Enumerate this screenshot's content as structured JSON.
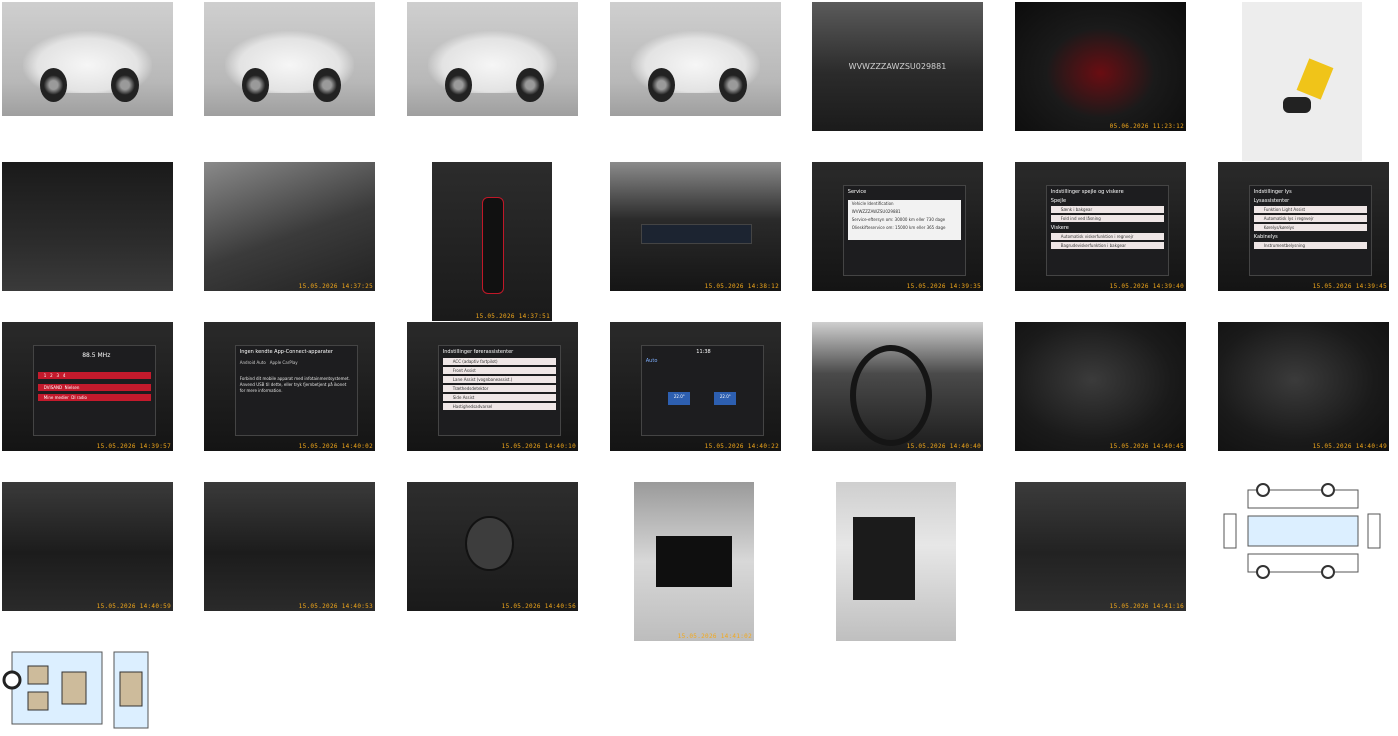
{
  "gallery": {
    "tiles": [
      {
        "stamp": "",
        "caption": ""
      },
      {
        "stamp": "",
        "caption": ""
      },
      {
        "stamp": "",
        "caption": ""
      },
      {
        "stamp": "",
        "caption": ""
      },
      {
        "stamp": "",
        "caption": "WVWZZZAWZSU029881"
      },
      {
        "stamp": "05.06.2026 11:23:12",
        "caption": ""
      },
      {
        "stamp": "",
        "caption": ""
      },
      {
        "stamp": "",
        "caption": ""
      },
      {
        "stamp": "15.05.2026 14:37:25",
        "caption": ""
      },
      {
        "stamp": "15.05.2026 14:37:51",
        "caption": ""
      },
      {
        "stamp": "15.05.2026 14:38:12",
        "caption": ""
      },
      {
        "stamp": "15.05.2026 14:39:35",
        "caption": "Service"
      },
      {
        "stamp": "15.05.2026 14:39:40",
        "caption": "Indstillinger spejle og viskere"
      },
      {
        "stamp": "15.05.2026 14:39:45",
        "caption": "Indstillinger lys"
      },
      {
        "stamp": "15.05.2026 14:39:57",
        "caption": "88.5 MHz"
      },
      {
        "stamp": "15.05.2026 14:40:02",
        "caption": "Ingen kendte App-Connect-apparater"
      },
      {
        "stamp": "15.05.2026 14:40:10",
        "caption": "Indstillinger førerassistenter"
      },
      {
        "stamp": "15.05.2026 14:40:22",
        "caption": ""
      },
      {
        "stamp": "15.05.2026 14:40:40",
        "caption": ""
      },
      {
        "stamp": "15.05.2026 14:40:45",
        "caption": ""
      },
      {
        "stamp": "15.05.2026 14:40:49",
        "caption": ""
      },
      {
        "stamp": "15.05.2026 14:40:59",
        "caption": ""
      },
      {
        "stamp": "15.05.2026 14:40:53",
        "caption": ""
      },
      {
        "stamp": "15.05.2026 14:40:56",
        "caption": ""
      },
      {
        "stamp": "15.05.2026 14:41:02",
        "caption": ""
      },
      {
        "stamp": "",
        "caption": ""
      },
      {
        "stamp": "15.05.2026 14:41:16",
        "caption": ""
      },
      {
        "stamp": "",
        "caption": ""
      },
      {
        "stamp": "",
        "caption": ""
      }
    ]
  },
  "screens": {
    "service": {
      "title": "Service",
      "lines": [
        "Vehicle Identification",
        "WVWZZZAWZSU029881",
        "Service-eftersyn om: 30000 km eller 730 dage",
        "Olieskifteservice om: 15000 km eller 365 dage"
      ]
    },
    "mirrors": {
      "title": "Indstillinger spejle og viskere",
      "sections": [
        "Spejle",
        "Viskere"
      ],
      "rows": [
        "Sænk i bakgear",
        "Fold ind ved låsning",
        "Automatisk viskerfunktion i regnvejr",
        "Bagrudeviskerfunktion i bakgear"
      ]
    },
    "lights": {
      "title": "Indstillinger lys",
      "sections": [
        "Lysassistenter",
        "Kabinelys"
      ],
      "rows": [
        "Funktion Light Assist",
        "Automatisk lys i regnvejr",
        "Kørelys/kørelys",
        "Instrumentbelysning"
      ]
    },
    "radio": {
      "freq": "88.5",
      "unit": "MHz",
      "presets": [
        "1",
        "2",
        "3",
        "4"
      ],
      "stations": [
        "DVISAND",
        "Nielsen",
        "Mine medier",
        "DI radio"
      ]
    },
    "appconnect": {
      "title": "Ingen kendte App-Connect-apparater",
      "body": "Forbind dit mobile apparat med infotainmentsystemet. Anvend USB til dette, eller tryk fjernbetjent på ikonet for mere information.",
      "buttons": [
        "Android Auto",
        "Apple CarPlay"
      ]
    },
    "assist": {
      "title": "Indstillinger førerassistenter",
      "rows": [
        "ACC (adaptiv fartpilot)",
        "Front Assist",
        "Lane Assist (vognbaneassist.)",
        "Træthedsdetektor",
        "Side Assist",
        "Hastighedsadvarsel"
      ]
    },
    "climate": {
      "top": "11:38",
      "temps": [
        "22.0°",
        "22.0°"
      ],
      "mode": "Auto"
    }
  },
  "colors": {
    "stamp": "#f3a81a",
    "screen_bg": "#1d1d1f",
    "accent_red": "#e0162b",
    "row_bg": "#efe6e6"
  }
}
